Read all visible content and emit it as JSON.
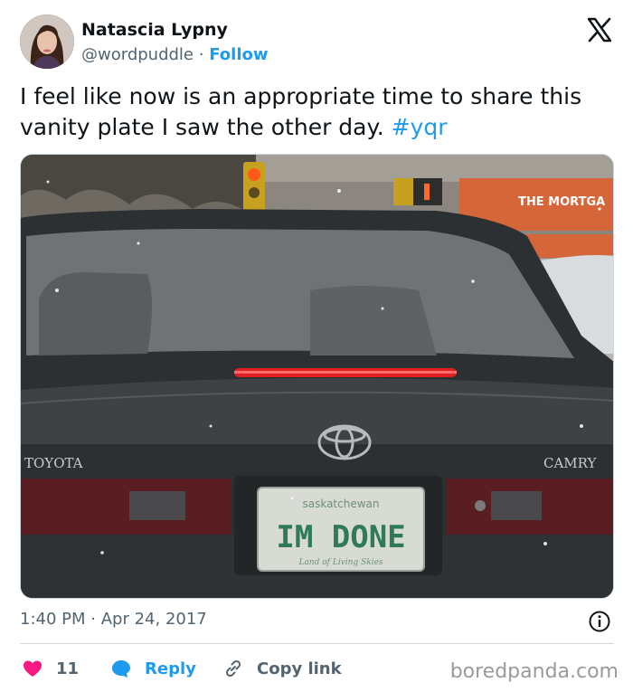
{
  "author": {
    "name": "Natascia Lypny",
    "handle": "@wordpuddle",
    "separator": "·",
    "follow_label": "Follow"
  },
  "tweet": {
    "text_line1": "I feel like now is an appropriate time to share this",
    "text_line2_before": "vanity plate I saw the other day. ",
    "hashtag": "#yqr"
  },
  "photo": {
    "sign_text": "THE MORTGA",
    "brand_left": "TOYOTA",
    "brand_right": "CAMRY",
    "plate_top": "saskatchewan",
    "plate_main": "IM DONE",
    "plate_bottom": "Land of Living Skies"
  },
  "meta": {
    "time": "1:40 PM",
    "separator": "·",
    "date": "Apr 24, 2017"
  },
  "actions": {
    "like_count": "11",
    "reply_label": "Reply",
    "copy_label": "Copy link"
  },
  "watermark": "boredpanda.com",
  "colors": {
    "accent": "#1d9bf0",
    "like": "#f91880",
    "text": "#0f1419",
    "muted": "#536471"
  }
}
